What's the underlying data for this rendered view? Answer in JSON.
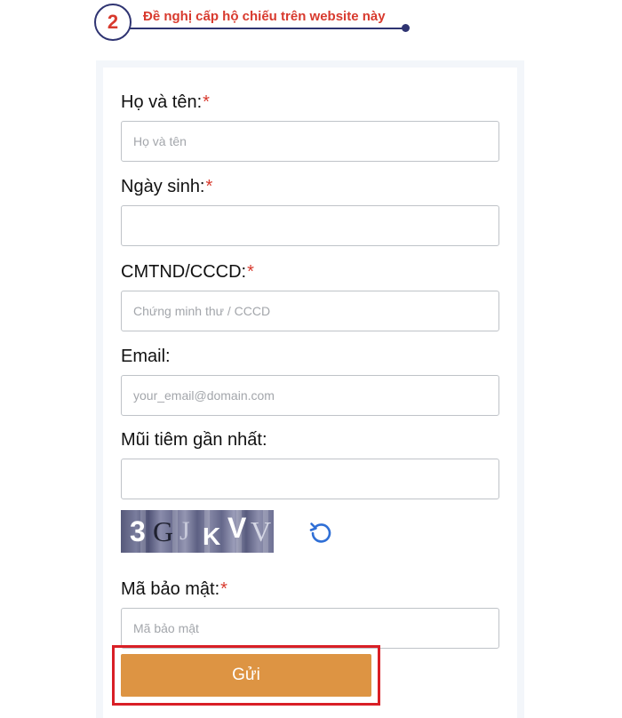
{
  "step": {
    "number": "2",
    "title": "Đề nghị cấp hộ chiếu trên website này"
  },
  "colors": {
    "accent_red": "#d83a2e",
    "step_navy": "#2f3472",
    "submit_orange": "#dd9443",
    "highlight_red": "#d91f26",
    "refresh_blue": "#2f6fd6"
  },
  "form": {
    "required_mark": "*",
    "full_name": {
      "label": "Họ và tên:",
      "placeholder": "Họ và tên",
      "value": ""
    },
    "birth_date": {
      "label": "Ngày sinh:",
      "placeholder": "",
      "value": ""
    },
    "id_number": {
      "label": "CMTND/CCCD:",
      "placeholder": "Chứng minh thư / CCCD",
      "value": ""
    },
    "email": {
      "label": "Email:",
      "placeholder": "your_email@domain.com",
      "value": ""
    },
    "latest_vaccine": {
      "label": "Mũi tiêm gần nhất:",
      "placeholder": "",
      "value": ""
    },
    "captcha": {
      "chars": [
        "3",
        "G",
        "J",
        "K",
        "V",
        "V"
      ],
      "refresh_icon": "refresh-icon"
    },
    "security_code": {
      "label": "Mã bảo mật:",
      "placeholder": "Mã bảo mật",
      "value": ""
    },
    "submit_label": "Gửi"
  }
}
